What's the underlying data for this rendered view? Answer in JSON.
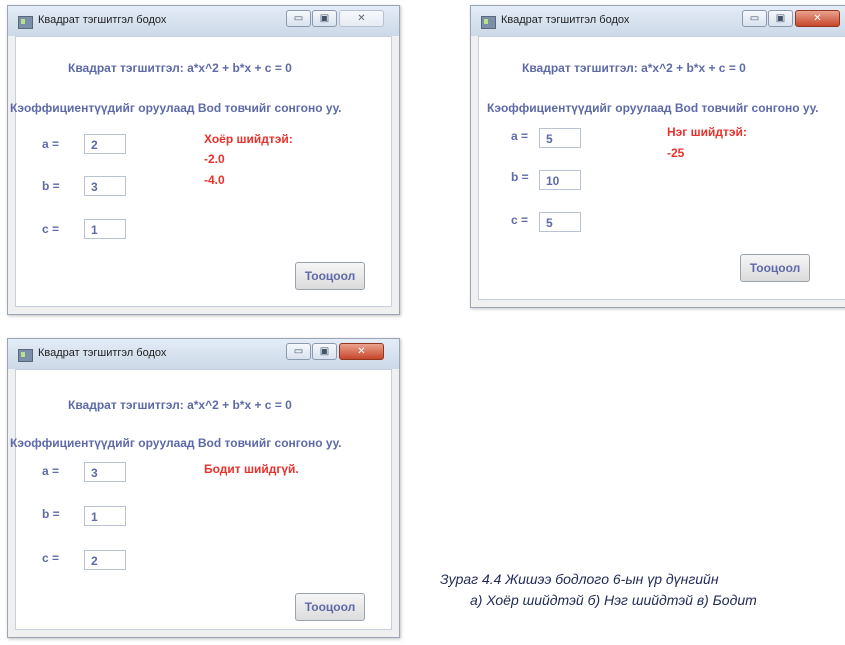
{
  "windows": [
    {
      "title": "Квадрат тэгшитгэл бодох",
      "equation": "Квадрат тэгшитгэл: a*x^2 + b*x + c = 0",
      "instruction": "Кэоффициентүүдийг оруулаад Bod товчийг сонгоно уу.",
      "labels": {
        "a": "a =",
        "b": "b =",
        "c": "c ="
      },
      "values": {
        "a": "2",
        "b": "3",
        "c": "1"
      },
      "result_title": "Хоёр шийдтэй:",
      "result_lines": [
        "-2.0",
        "-4.0"
      ],
      "button_label": "Тооцоол",
      "controls": {
        "min": "▭",
        "max": "▣",
        "close": "✕"
      }
    },
    {
      "title": "Квадрат тэгшитгэл бодох",
      "equation": "Квадрат тэгшитгэл: a*x^2 + b*x + c = 0",
      "instruction": "Кэоффициентүүдийг оруулаад Bod товчийг сонгоно уу.",
      "labels": {
        "a": "a =",
        "b": "b =",
        "c": "c ="
      },
      "values": {
        "a": "5",
        "b": "10",
        "c": "5"
      },
      "result_title": "Нэг шийдтэй:",
      "result_lines": [
        "-25"
      ],
      "button_label": "Тооцоол",
      "controls": {
        "min": "▭",
        "max": "▣",
        "close": "✕"
      }
    },
    {
      "title": "Квадрат тэгшитгэл бодох",
      "equation": "Квадрат тэгшитгэл: a*x^2 + b*x + c = 0",
      "instruction": "Кэоффициентүүдийг оруулаад Bod товчийг сонгоно уу.",
      "labels": {
        "a": "a =",
        "b": "b =",
        "c": "c ="
      },
      "values": {
        "a": "3",
        "b": "1",
        "c": "2"
      },
      "result_title": "Бодит шийдгүй.",
      "result_lines": [],
      "button_label": "Тооцоол",
      "controls": {
        "min": "▭",
        "max": "▣",
        "close": "✕"
      }
    }
  ],
  "caption": {
    "line1": "Зураг 4.4 Жишээ бодлогo 6-ын үр дүнгийн",
    "line2": "а) Хоёр шийдтэй б) Нэг шийдтэй в) Бодит"
  }
}
